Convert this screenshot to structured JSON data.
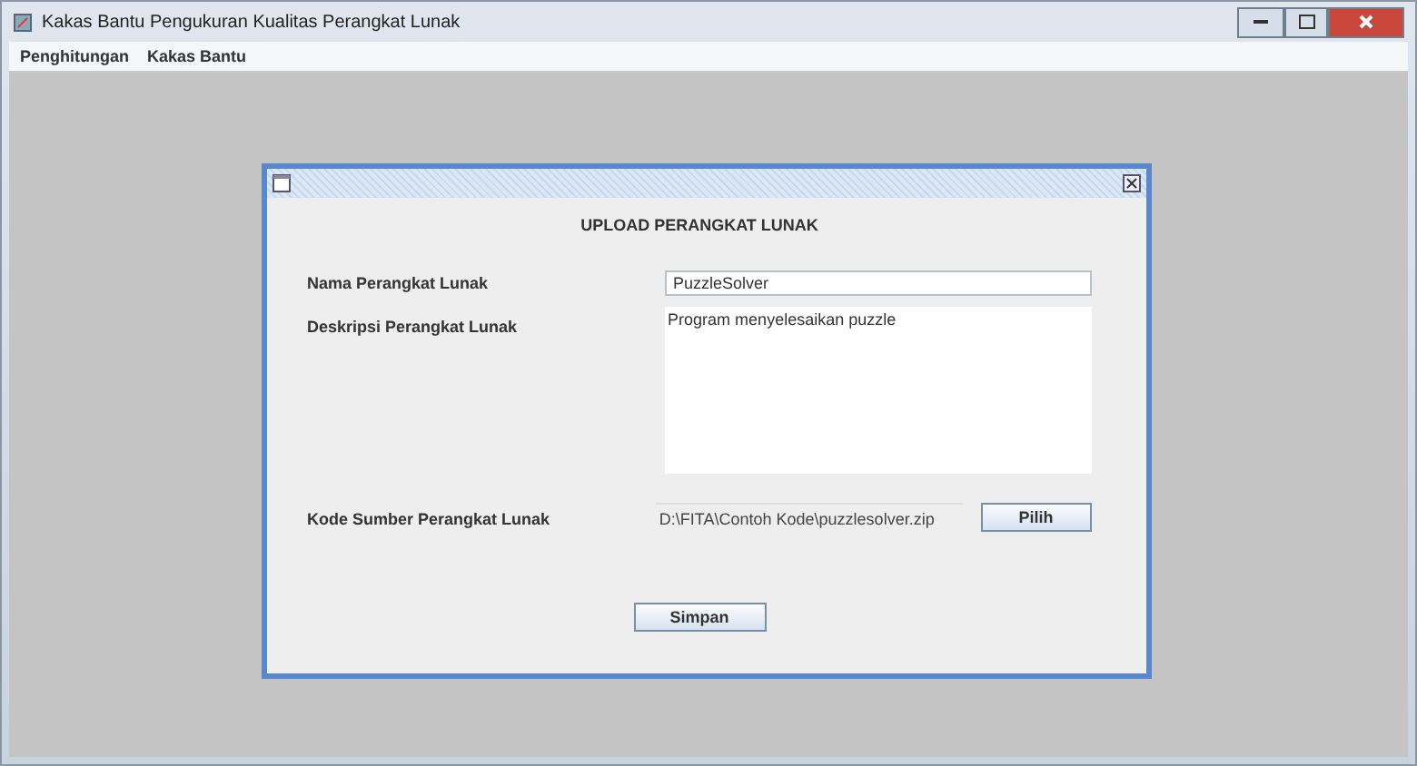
{
  "window": {
    "title": "Kakas Bantu Pengukuran Kualitas Perangkat Lunak"
  },
  "menu": [
    "Penghitungan",
    "Kakas Bantu"
  ],
  "dialog": {
    "heading": "UPLOAD PERANGKAT LUNAK",
    "name_label": "Nama Perangkat Lunak",
    "name_value": "PuzzleSolver",
    "description_label": "Deskripsi Perangkat Lunak",
    "description_value": "Program menyelesaikan puzzle",
    "source_label": "Kode Sumber Perangkat Lunak",
    "source_value": "D:\\FITA\\Contoh Kode\\puzzlesolver.zip",
    "choose_button": "Pilih",
    "save_button": "Simpan"
  }
}
